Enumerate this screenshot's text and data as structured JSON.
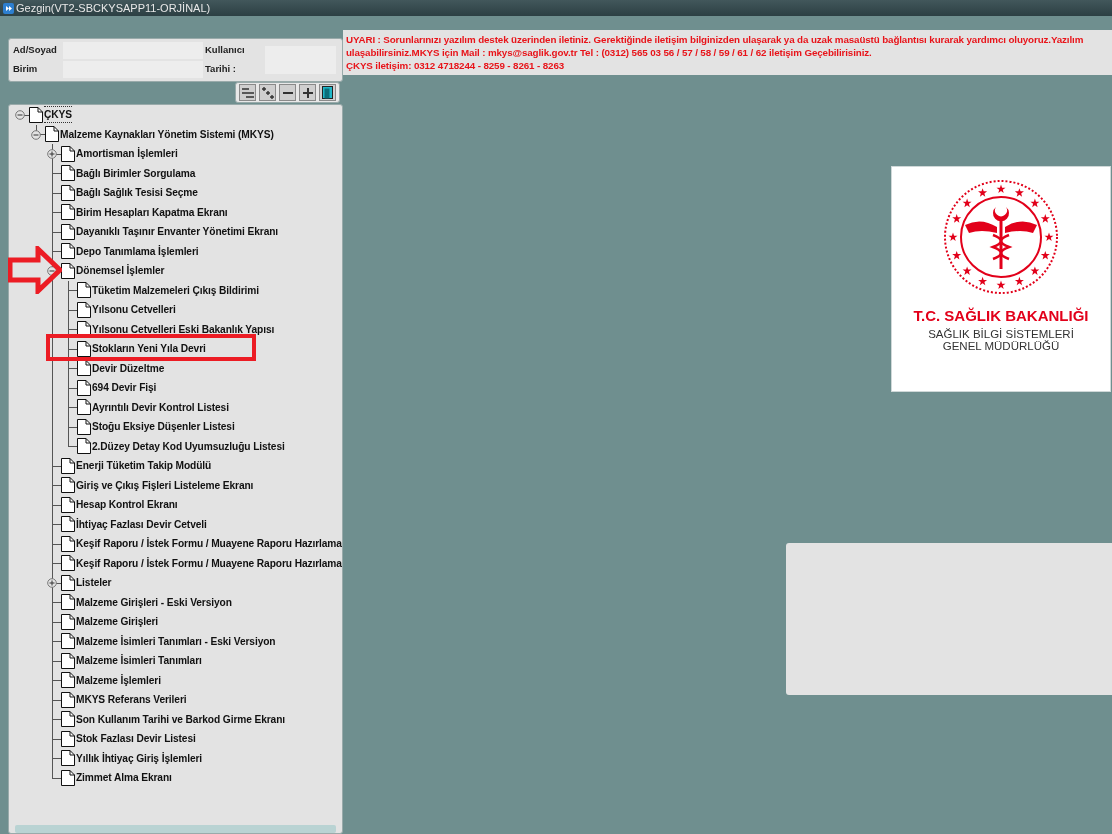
{
  "window": {
    "title": "Gezgin(VT2-SBCKYSAPP11-ORJİNAL)"
  },
  "user_panel": {
    "labels": [
      "Ad/Soyad",
      "Birim",
      "Kullanıcı",
      "Tarihi :"
    ]
  },
  "warning": {
    "lines": [
      "UYARI : Sorunlarınızı yazılım destek üzerinden iletiniz. Gerektiğinde iletişim bilginizden ulaşarak ya da uzak masaüstü bağlantısı kurarak yardımcı oluyoruz.Yazılım",
      "ulaşabilirsiniz.MKYS için Mail : mkys@saglik.gov.tr  Tel : (0312) 565 03 56 / 57 / 58 / 59  / 61 / 62  iletişim Geçebilirisiniz.",
      "ÇKYS iletişim: 0312 4718244 - 8259 - 8261 - 8263"
    ]
  },
  "toolbar": [
    {
      "kind": "collapse"
    },
    {
      "kind": "expand"
    },
    {
      "kind": "minus"
    },
    {
      "kind": "plus"
    },
    {
      "kind": "exit"
    }
  ],
  "tree": [
    {
      "label": "ÇKYS",
      "kind": "node",
      "expanded": true,
      "selected": true,
      "children": [
        {
          "label": "Malzeme Kaynakları Yönetim Sistemi (MKYS)",
          "kind": "node",
          "expanded": true,
          "selected": false,
          "children": [
            {
              "label": "Amortisman İşlemleri",
              "kind": "node",
              "expanded": false,
              "selected": false
            },
            {
              "label": "Bağlı Birimler Sorgulama",
              "kind": "leaf",
              "selected": false
            },
            {
              "label": "Bağlı Sağlık Tesisi Seçme",
              "kind": "leaf",
              "selected": false
            },
            {
              "label": "Birim Hesapları Kapatma Ekranı",
              "kind": "leaf",
              "selected": false
            },
            {
              "label": "Dayanıklı Taşınır Envanter Yönetimi Ekranı",
              "kind": "leaf",
              "selected": false
            },
            {
              "label": "Depo Tanımlama İşlemleri",
              "kind": "leaf",
              "selected": false
            },
            {
              "label": "Dönemsel İşlemler",
              "kind": "node",
              "expanded": true,
              "selected": false,
              "children": [
                {
                  "label": "Tüketim Malzemeleri Çıkış Bildirimi",
                  "kind": "leaf",
                  "selected": false
                },
                {
                  "label": "Yılsonu Cetvelleri",
                  "kind": "leaf",
                  "selected": false
                },
                {
                  "label": "Yılsonu Cetvelleri Eski Bakanlık Yapısı",
                  "kind": "leaf",
                  "selected": false
                },
                {
                  "label": "Stokların Yeni Yıla Devri",
                  "kind": "leaf",
                  "selected": false
                },
                {
                  "label": "Devir Düzeltme",
                  "kind": "leaf",
                  "selected": false
                },
                {
                  "label": "694 Devir Fişi",
                  "kind": "leaf",
                  "selected": false
                },
                {
                  "label": "Ayrıntılı Devir Kontrol Listesi",
                  "kind": "leaf",
                  "selected": false
                },
                {
                  "label": "Stoğu Eksiye Düşenler Listesi",
                  "kind": "leaf",
                  "selected": false
                },
                {
                  "label": "2.Düzey Detay Kod Uyumsuzluğu Listesi",
                  "kind": "leaf",
                  "selected": false
                }
              ]
            },
            {
              "label": "Enerji Tüketim Takip Modülü",
              "kind": "leaf",
              "selected": false
            },
            {
              "label": "Giriş ve Çıkış Fişleri Listeleme Ekranı",
              "kind": "leaf",
              "selected": false
            },
            {
              "label": "Hesap Kontrol Ekranı",
              "kind": "leaf",
              "selected": false
            },
            {
              "label": "İhtiyaç Fazlası Devir Cetveli",
              "kind": "leaf",
              "selected": false
            },
            {
              "label": "Keşif Raporu / İstek Formu / Muayene Raporu Hazırlama",
              "kind": "leaf",
              "selected": false
            },
            {
              "label": "Keşif Raporu / İstek Formu / Muayene Raporu Hazırlama",
              "kind": "leaf",
              "selected": false
            },
            {
              "label": "Listeler",
              "kind": "node",
              "expanded": false,
              "selected": false
            },
            {
              "label": "Malzeme Girişleri - Eski Versiyon",
              "kind": "leaf",
              "selected": false
            },
            {
              "label": "Malzeme Girişleri",
              "kind": "leaf",
              "selected": false
            },
            {
              "label": "Malzeme İsimleri Tanımları - Eski Versiyon",
              "kind": "leaf",
              "selected": false
            },
            {
              "label": "Malzeme İsimleri Tanımları",
              "kind": "leaf",
              "selected": false
            },
            {
              "label": "Malzeme İşlemleri",
              "kind": "leaf",
              "selected": false
            },
            {
              "label": "MKYS Referans Verileri",
              "kind": "leaf",
              "selected": false
            },
            {
              "label": "Son Kullanım Tarihi ve Barkod Girme Ekranı",
              "kind": "leaf",
              "selected": false
            },
            {
              "label": "Stok Fazlası Devir Listesi",
              "kind": "leaf",
              "selected": false
            },
            {
              "label": "Yıllık İhtiyaç Giriş İşlemleri",
              "kind": "leaf",
              "selected": false
            },
            {
              "label": "Zimmet Alma Ekranı",
              "kind": "leaf",
              "selected": false
            }
          ]
        }
      ]
    }
  ],
  "logo": {
    "title": "T.C. SAĞLIK BAKANLIĞI",
    "subtitle_lines": [
      "SAĞLIK BİLGİ SİSTEMLERİ",
      "GENEL MÜDÜRLÜĞÜ"
    ]
  }
}
